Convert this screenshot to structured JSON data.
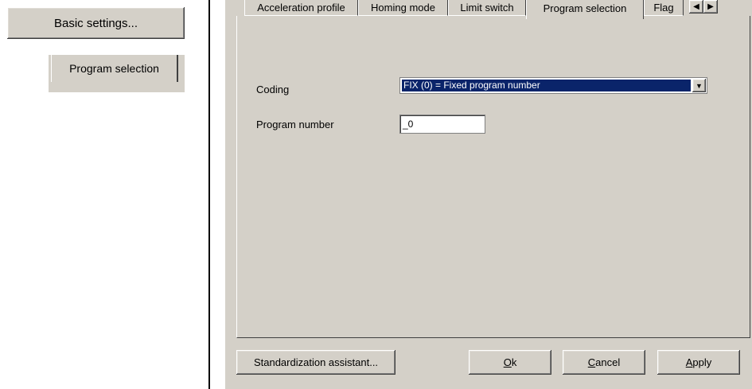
{
  "left": {
    "basic_settings_button": "Basic settings...",
    "program_selection_tab": "Program selection"
  },
  "dialog": {
    "tabs": [
      {
        "label": "Acceleration profile"
      },
      {
        "label": "Homing mode"
      },
      {
        "label": "Limit switch"
      },
      {
        "label": "Program selection",
        "active": true
      },
      {
        "label": "Flag"
      }
    ],
    "scroll_left_icon": "triangle-left",
    "scroll_right_icon": "triangle-right",
    "fields": {
      "coding_label": "Coding",
      "coding_value": "FIX (0) = Fixed program number",
      "program_number_label": "Program number",
      "program_number_value": "_0"
    },
    "buttons": {
      "standardization": "Standardization assistant...",
      "ok_accel": "O",
      "ok_rest": "k",
      "cancel_accel": "C",
      "cancel_rest": "ancel",
      "apply_accel": "A",
      "apply_rest": "pply"
    }
  },
  "colors": {
    "face": "#d4d0c8",
    "selection": "#0a246a"
  }
}
